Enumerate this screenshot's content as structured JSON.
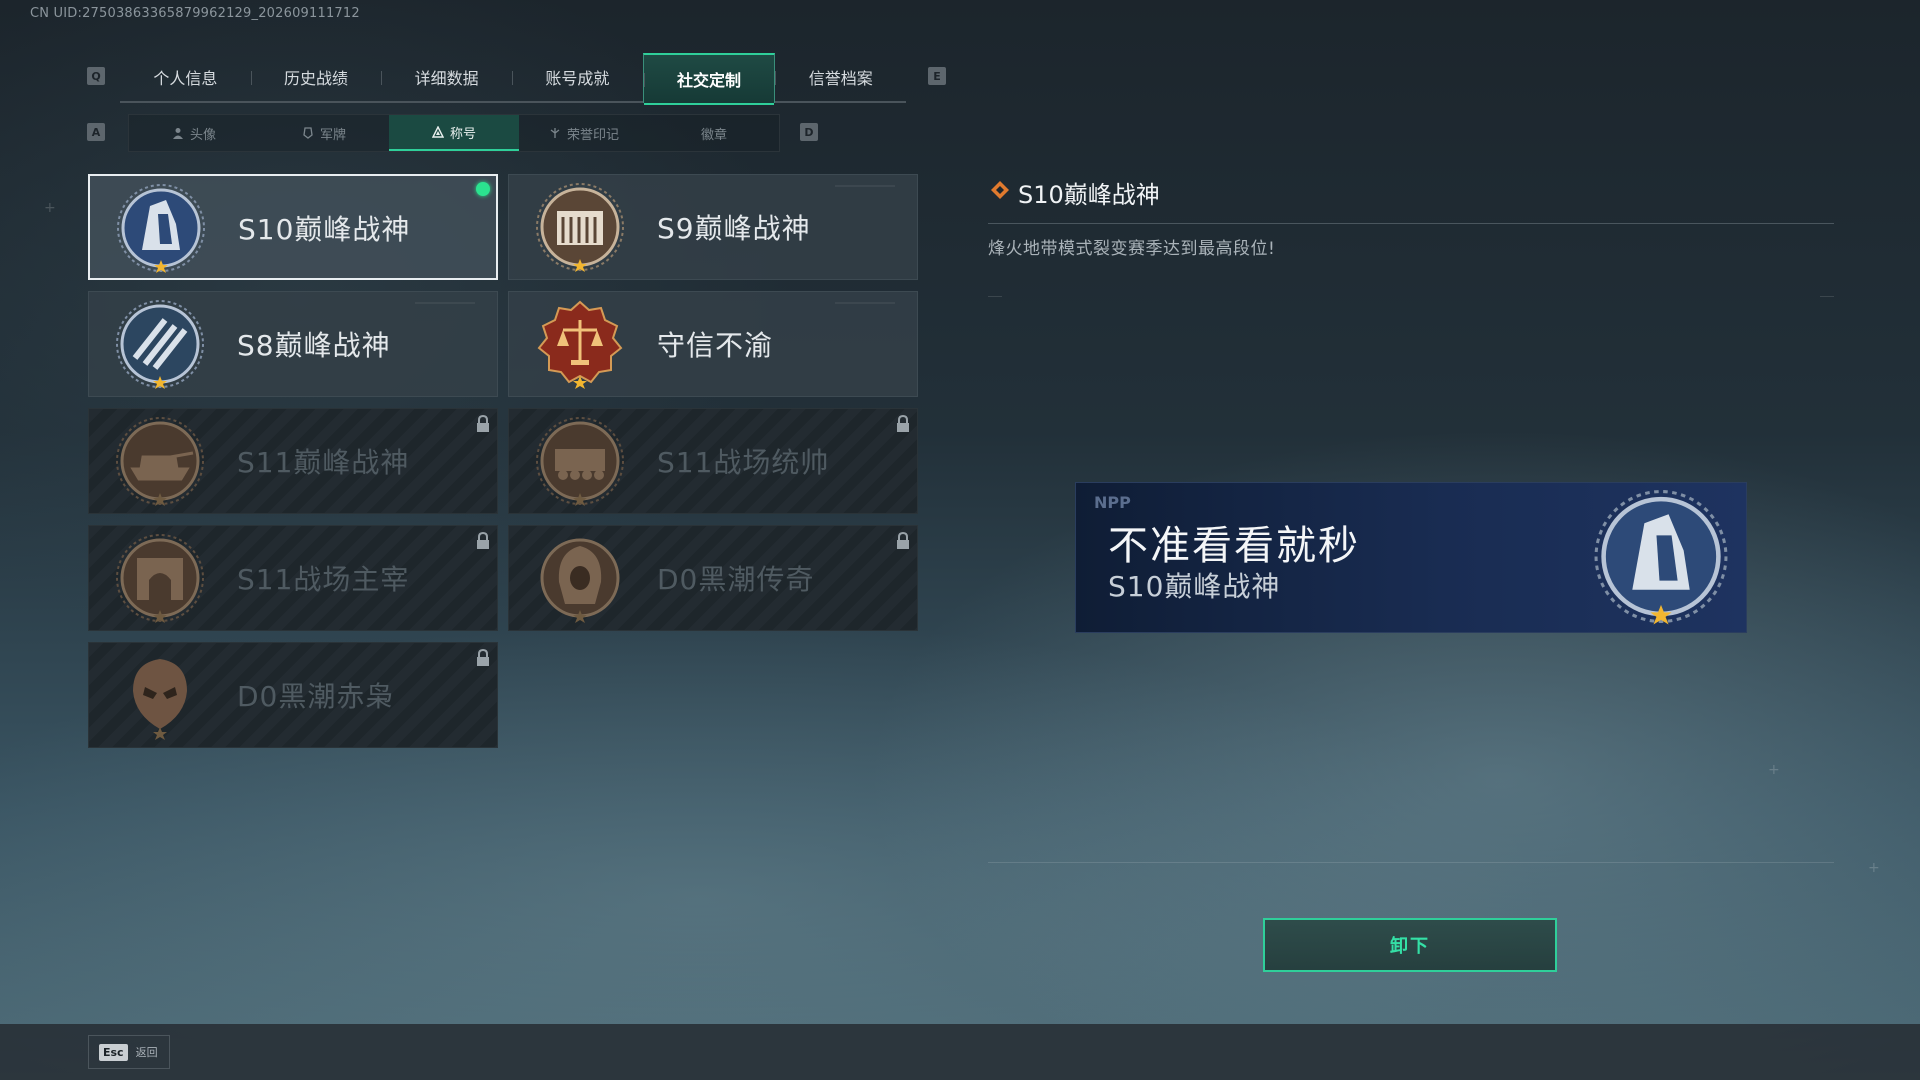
{
  "uid_text": "CN UID:275038633658799621​29_202609111712",
  "main_tabs": {
    "key_left": "Q",
    "key_right": "E",
    "items": [
      {
        "label": "个人信息"
      },
      {
        "label": "历史战绩"
      },
      {
        "label": "详细数据"
      },
      {
        "label": "账号成就"
      },
      {
        "label": "社交定制",
        "active": true
      },
      {
        "label": "信誉档案"
      }
    ]
  },
  "sub_tabs": {
    "key_left": "A",
    "key_right": "D",
    "items": [
      {
        "label": "头像",
        "icon": "person-icon"
      },
      {
        "label": "军牌",
        "icon": "dogtag-icon"
      },
      {
        "label": "称号",
        "icon": "triangle-icon",
        "active": true
      },
      {
        "label": "荣誉印记",
        "icon": "honor-icon"
      },
      {
        "label": "徽章",
        "icon": ""
      }
    ]
  },
  "titles": [
    {
      "name": "S10巅峰战神",
      "locked": false,
      "selected": true,
      "equipped": true,
      "emblem": "tower-emblem"
    },
    {
      "name": "S9巅峰战神",
      "locked": false,
      "selected": false,
      "equipped": false,
      "emblem": "building-emblem"
    },
    {
      "name": "S8巅峰战神",
      "locked": false,
      "selected": false,
      "equipped": false,
      "emblem": "stripes-emblem"
    },
    {
      "name": "守信不渝",
      "locked": false,
      "selected": false,
      "equipped": false,
      "emblem": "scales-emblem"
    },
    {
      "name": "S11巅峰战神",
      "locked": true,
      "selected": false,
      "equipped": false,
      "emblem": "tank-emblem"
    },
    {
      "name": "S11战场统帅",
      "locked": true,
      "selected": false,
      "equipped": false,
      "emblem": "vehicle-emblem"
    },
    {
      "name": "S11战场主宰",
      "locked": true,
      "selected": false,
      "equipped": false,
      "emblem": "arch-emblem"
    },
    {
      "name": "D0黑潮传奇",
      "locked": true,
      "selected": false,
      "equipped": false,
      "emblem": "hooded-emblem"
    },
    {
      "name": "D0黑潮赤枭",
      "locked": true,
      "selected": false,
      "equipped": false,
      "emblem": "mask-emblem"
    }
  ],
  "detail": {
    "title": "S10巅峰战神",
    "description": "烽火地带模式裂变赛季达到最高段位!"
  },
  "banner": {
    "nickname": "不准看看就秒",
    "title": "S10巅峰战神",
    "logo": "NPP"
  },
  "unequip_label": "卸下",
  "esc": {
    "key": "Esc",
    "label": "返回"
  },
  "colors": {
    "accent": "#2fcf9a",
    "equipped_dot": "#2be38f",
    "banner_bg": "#192c52"
  }
}
